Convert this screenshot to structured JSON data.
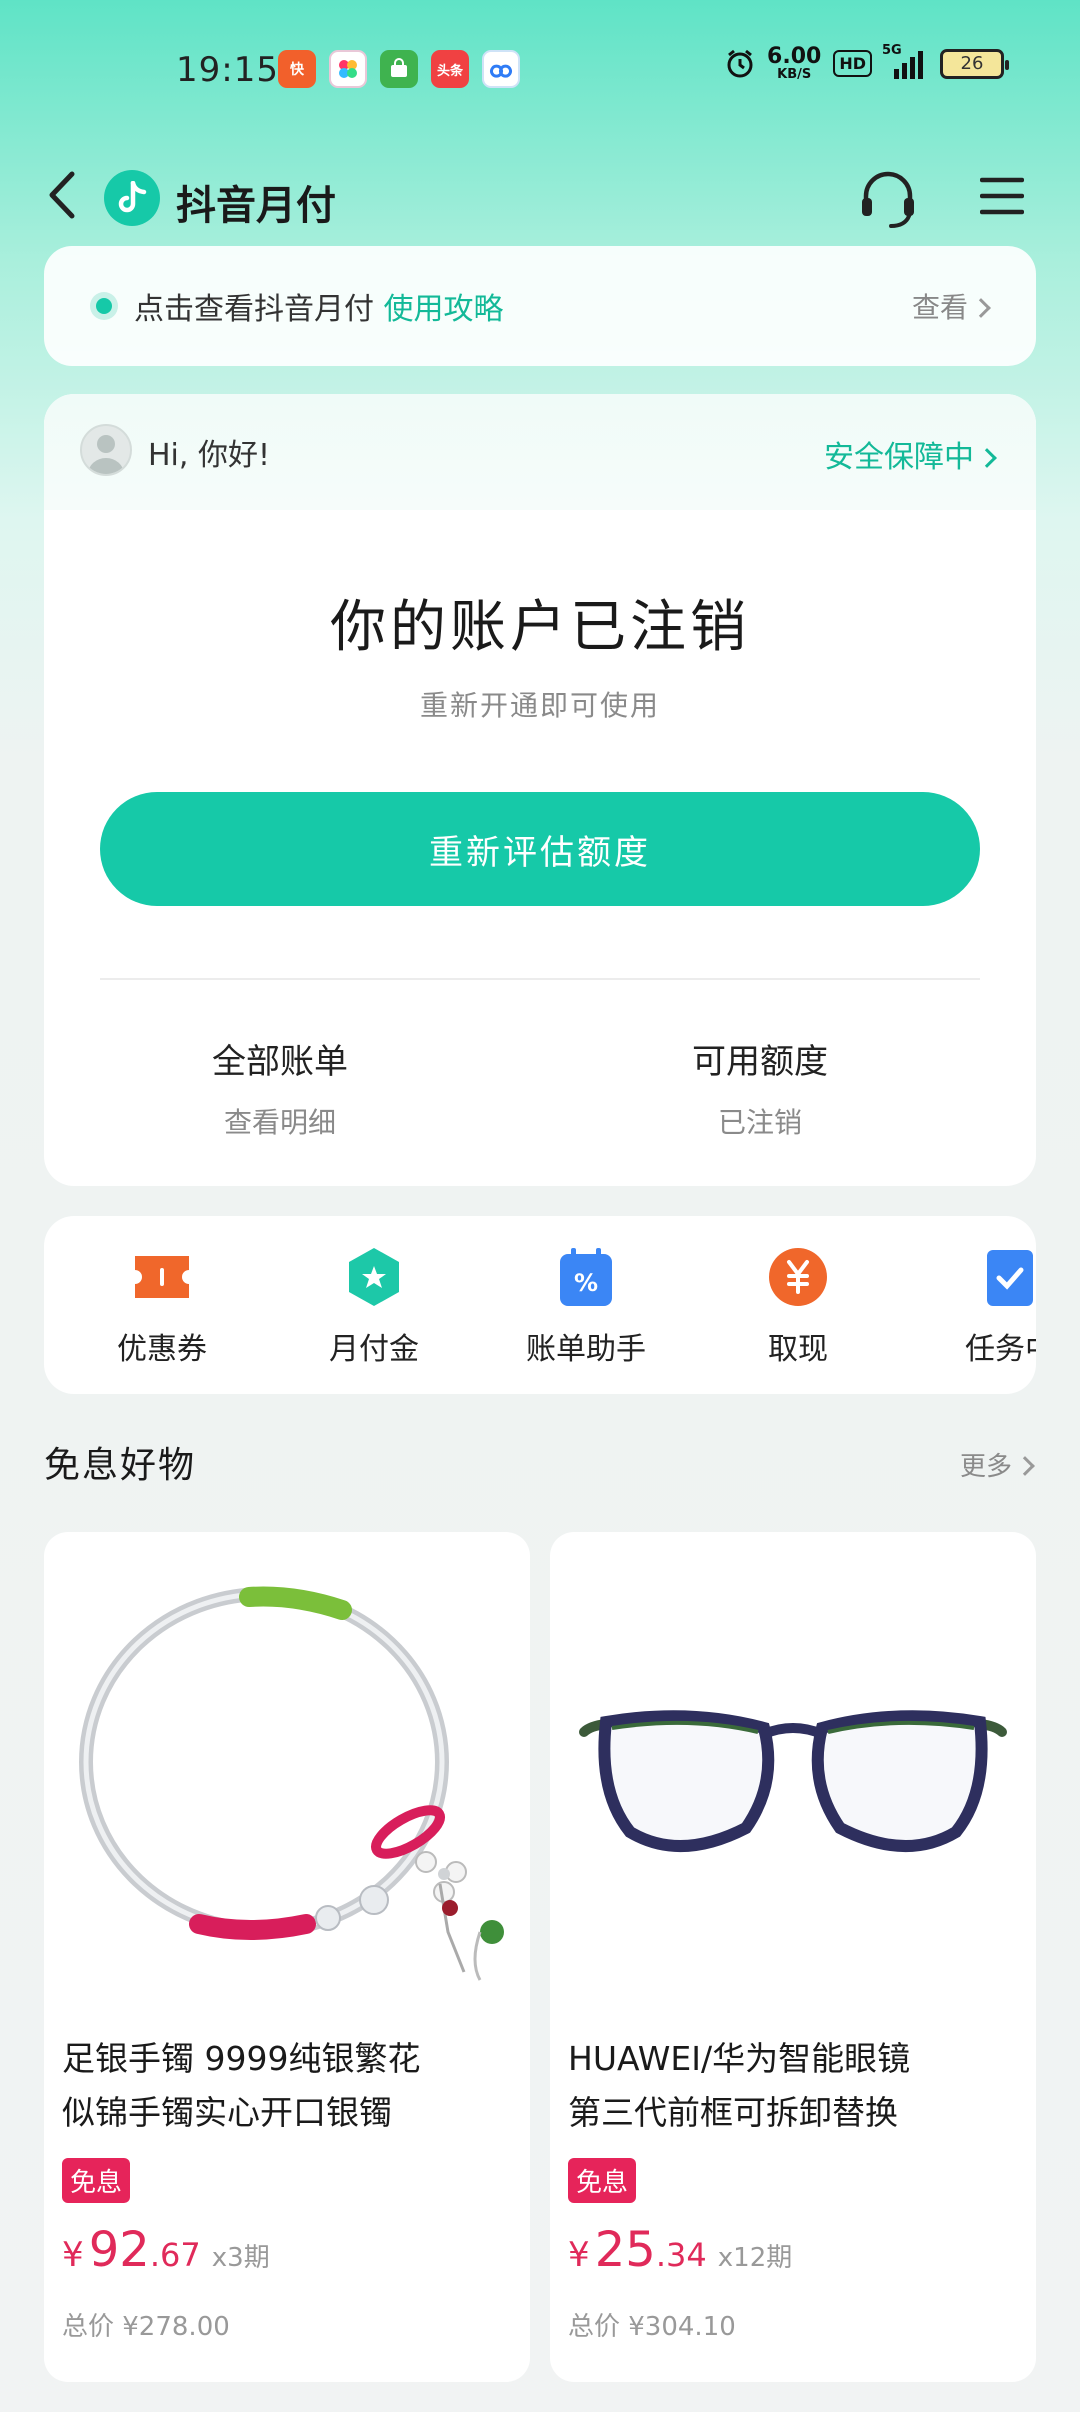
{
  "status_bar": {
    "time": "19:15",
    "net_speed_value": "6.00",
    "net_speed_unit": "KB/S",
    "hd": "HD",
    "signal": "5G",
    "battery": "26",
    "app_badges": [
      "快",
      "",
      "",
      "头条",
      ""
    ]
  },
  "header": {
    "title": "抖音月付"
  },
  "guide": {
    "text": "点击查看抖音月付",
    "link": "使用攻略",
    "more": "查看"
  },
  "account": {
    "greeting": "Hi, 你好!",
    "security": "安全保障中",
    "status": "你的账户已注销",
    "subtitle": "重新开通即可使用",
    "button": "重新评估额度",
    "bills_label": "全部账单",
    "bills_sub": "查看明细",
    "limit_label": "可用额度",
    "limit_sub": "已注销"
  },
  "services": [
    {
      "label": "优惠券",
      "icon": "coupon-icon",
      "color": "#f0672b"
    },
    {
      "label": "月付金",
      "icon": "monthly-gold-icon",
      "color": "#1dc8a8"
    },
    {
      "label": "账单助手",
      "icon": "bill-assistant-icon",
      "color": "#3b86f5"
    },
    {
      "label": "取现",
      "icon": "cash-icon",
      "color": "#f0672b"
    },
    {
      "label": "任务中",
      "icon": "task-icon",
      "color": "#3b86f5"
    }
  ],
  "section": {
    "title": "免息好物",
    "more": "更多"
  },
  "products": [
    {
      "name_line1": "足银手镯 9999纯银繁花",
      "name_line2": "似锦手镯实心开口银镯",
      "tag": "免息",
      "currency": "¥",
      "price_int": "92",
      "price_dec": ".67",
      "installments": "x3期",
      "total": "总价 ¥278.00",
      "image": "silver-bracelet"
    },
    {
      "name_line1": "HUAWEI/华为智能眼镜",
      "name_line2": "第三代前框可拆卸替换",
      "tag": "免息",
      "currency": "¥",
      "price_int": "25",
      "price_dec": ".34",
      "installments": "x12期",
      "total": "总价 ¥304.10",
      "image": "smart-glasses"
    }
  ],
  "colors": {
    "accent": "#16c9a8",
    "price": "#e02a5a",
    "tag": "#e6245a"
  }
}
